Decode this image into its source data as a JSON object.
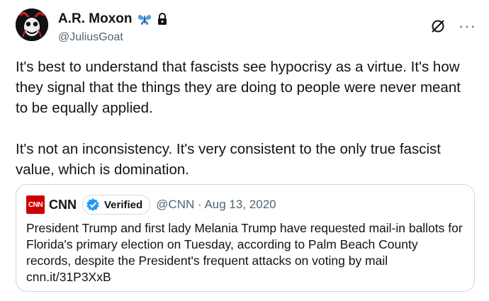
{
  "author": {
    "display_name": "A.R. Moxon",
    "handle": "@JuliusGoat",
    "avatar_icon": "avatar-goat",
    "badges": [
      "butterfly-icon",
      "lock-icon"
    ]
  },
  "actions": {
    "grok_icon": "slash-circle-icon",
    "more_label": "···"
  },
  "tweet": {
    "text": "It's best to understand that fascists see hypocrisy as a virtue. It's how they signal that the things they are doing to people were never meant to be equally applied.\n\nIt's not an inconsistency. It's very consistent to the only true fascist value, which is domination."
  },
  "quote": {
    "logo_text": "CNN",
    "name": "CNN",
    "verified_label": "Verified",
    "meta": "@CNN · Aug 13, 2020",
    "text": "President Trump and first lady Melania Trump have requested mail-in ballots for Florida's primary election on Tuesday, according to Palm Beach County records, despite the President's frequent attacks on voting by mail\ncnn.it/31P3XxB"
  },
  "colors": {
    "text": "#0f1419",
    "secondary": "#536471",
    "border": "#cfd9de",
    "verified_blue": "#1d9bf0",
    "cnn_red": "#cc0000"
  }
}
